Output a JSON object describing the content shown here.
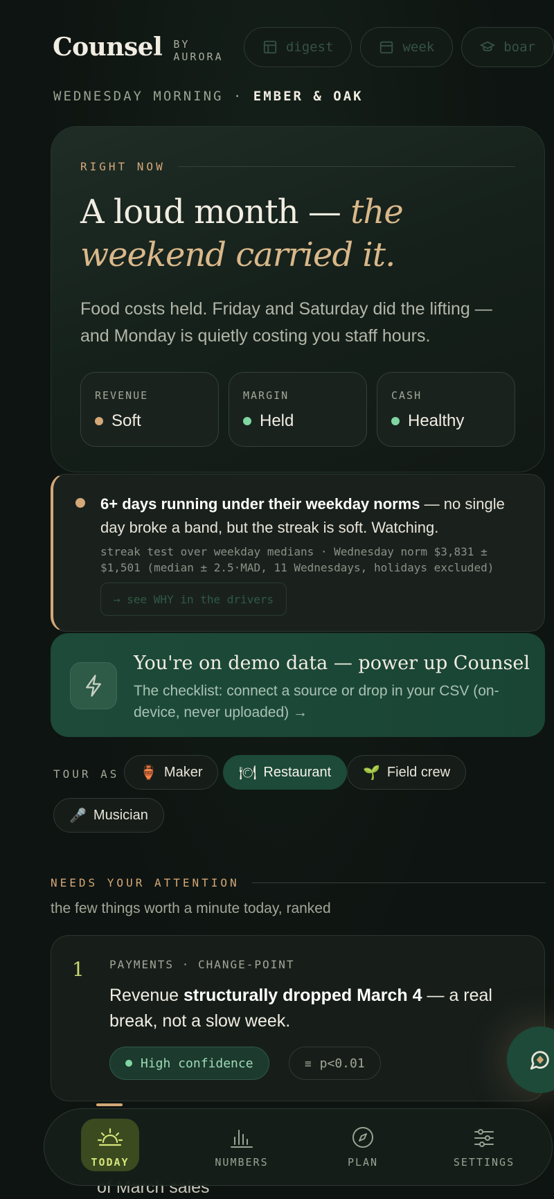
{
  "header": {
    "brand": "Counsel",
    "byline": "BY AURORA",
    "nav": [
      {
        "label": "digest",
        "icon": "layout-icon"
      },
      {
        "label": "week",
        "icon": "calendar-icon"
      },
      {
        "label": "boar",
        "icon": "graduation-cap-icon"
      }
    ]
  },
  "dateline": {
    "prefix": "WEDNESDAY MORNING ·",
    "place": "EMBER & OAK"
  },
  "hero": {
    "eyebrow": "RIGHT NOW",
    "title_plain": "A loud month — ",
    "title_em": "the weekend carried it.",
    "subtitle": "Food costs held. Friday and Saturday did the lifting — and Monday is quietly costing you staff hours.",
    "metrics": [
      {
        "label": "REVENUE",
        "value": "Soft",
        "color": "#d4a878"
      },
      {
        "label": "MARGIN",
        "value": "Held",
        "color": "#7fd6a2"
      },
      {
        "label": "CASH",
        "value": "Healthy",
        "color": "#7fd6a2"
      }
    ]
  },
  "alert": {
    "headline": "6+ days running under their weekday norms",
    "rest": " — no single day broke a band, but the streak is soft. Watching.",
    "meta": "streak test over weekday medians · Wednesday norm $3,831 ± $1,501 (median ± 2.5·MAD, 11 Wednesdays, holidays excluded)",
    "button": "→ see WHY in the drivers"
  },
  "demo": {
    "title": "You're on demo data — power up Counsel",
    "subtitle": "The checklist: connect a source or drop in your CSV (on-device, never uploaded) →"
  },
  "tour": {
    "label": "TOUR AS",
    "options": [
      {
        "emoji": "🏺",
        "label": "Maker"
      },
      {
        "emoji": "🍽",
        "label": "Restaurant"
      },
      {
        "emoji": "🌱",
        "label": "Field crew"
      },
      {
        "emoji": "🎤",
        "label": "Musician"
      }
    ]
  },
  "attention": {
    "eyebrow": "NEEDS YOUR ATTENTION",
    "subtitle": "the few things worth a minute today, ranked",
    "items": [
      {
        "rank": "1",
        "kicker": "PAYMENTS · CHANGE-POINT",
        "text_pre": "Revenue ",
        "text_bold": "structurally dropped March 4",
        "text_post": " — a real break, not a slow week.",
        "confidence": "High confidence",
        "pvalue": "p<0.01"
      }
    ],
    "peek_text": "of March sales"
  },
  "bottom_nav": [
    {
      "label": "TODAY",
      "icon": "sunrise-icon"
    },
    {
      "label": "NUMBERS",
      "icon": "bar-chart-icon"
    },
    {
      "label": "PLAN",
      "icon": "compass-icon"
    },
    {
      "label": "SETTINGS",
      "icon": "sliders-icon"
    }
  ]
}
